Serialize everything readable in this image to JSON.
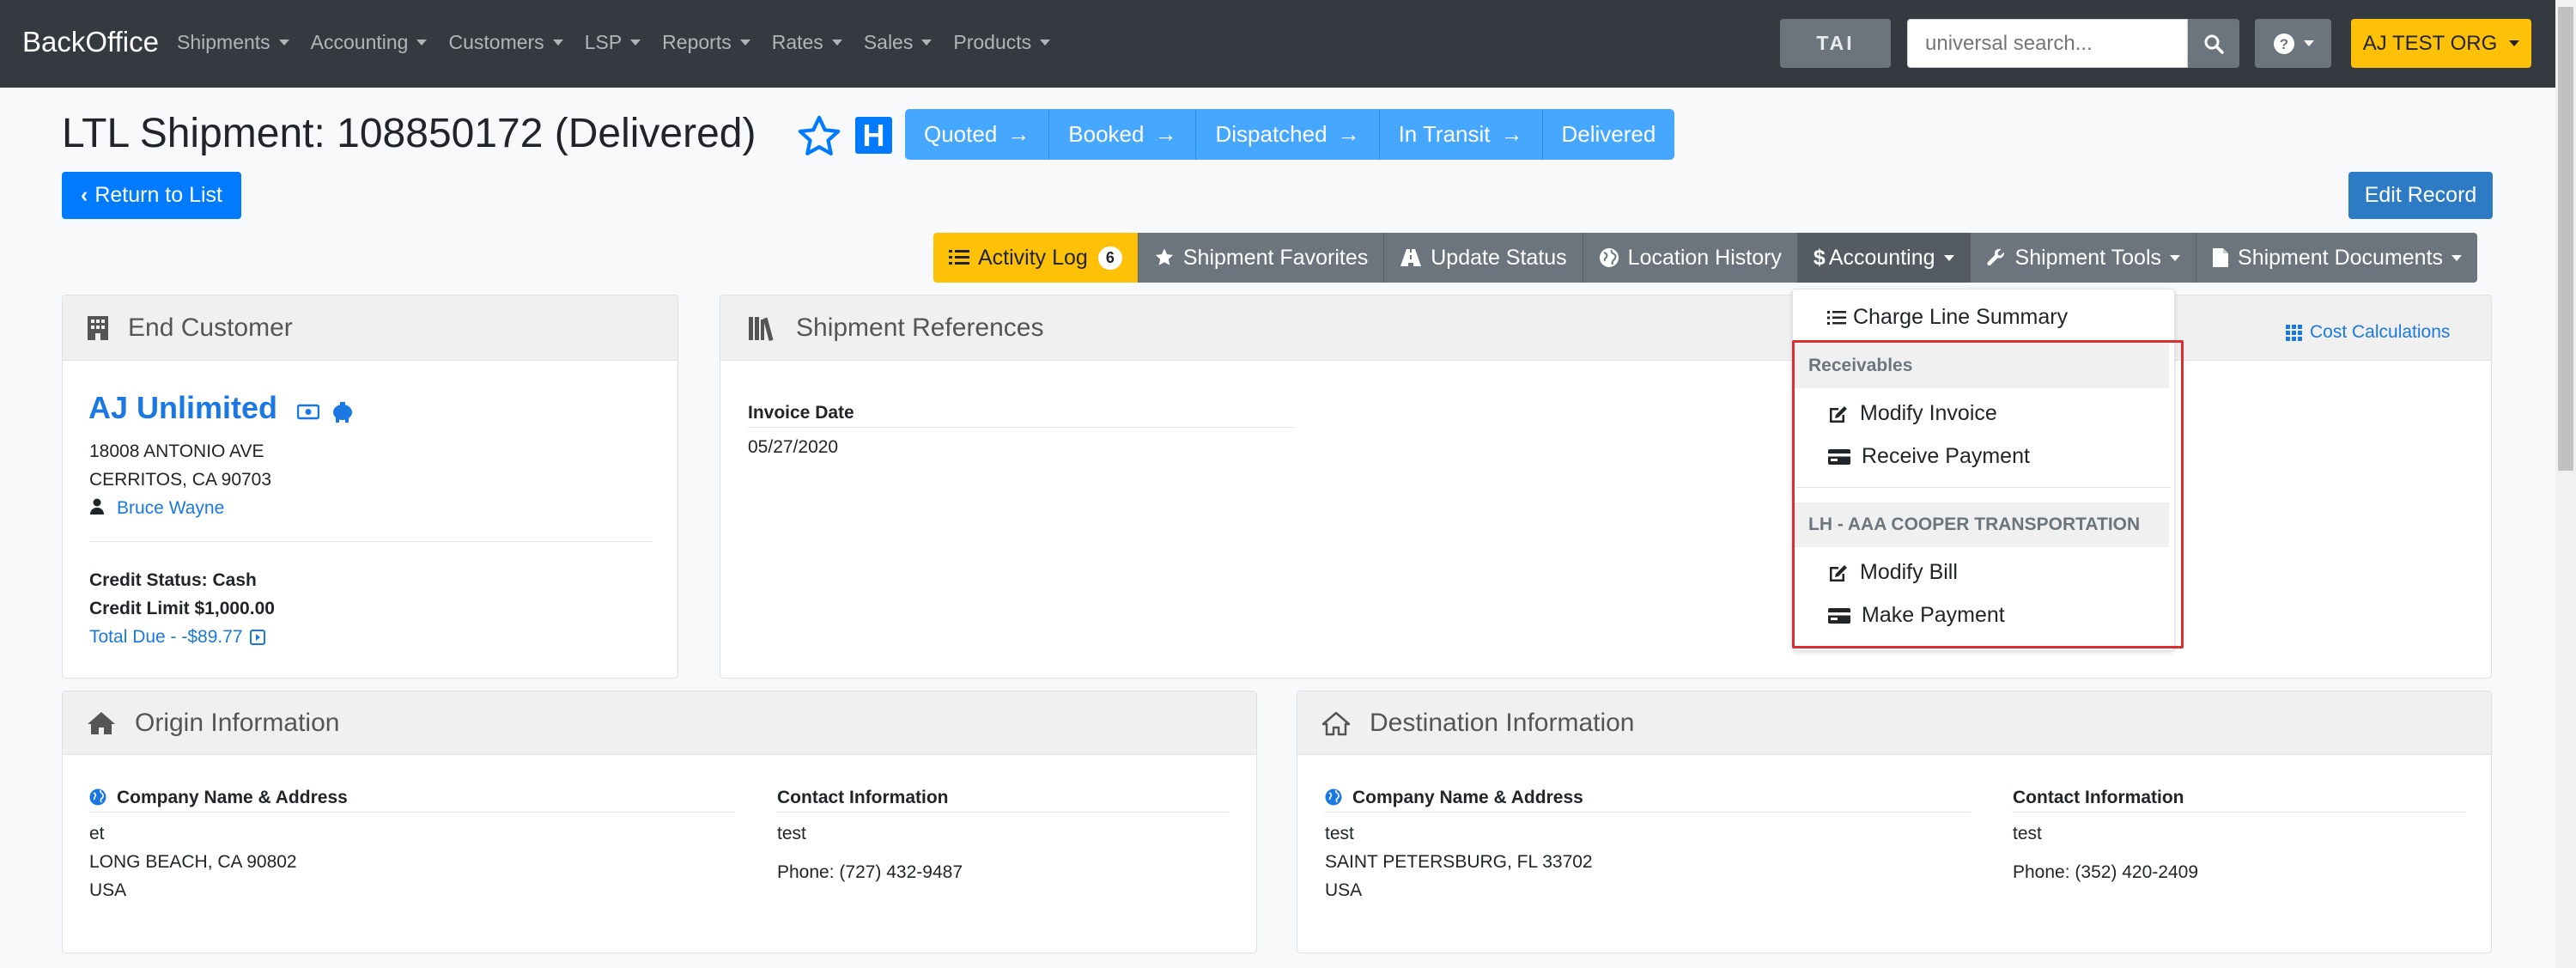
{
  "navbar": {
    "brand": "BackOffice",
    "items": [
      "Shipments",
      "Accounting",
      "Customers",
      "LSP",
      "Reports",
      "Rates",
      "Sales",
      "Products"
    ],
    "tai_label": "TAI",
    "search_placeholder": "universal search...",
    "org_label": "AJ TEST ORG"
  },
  "header": {
    "title": "LTL Shipment: 108850172 (Delivered)",
    "h_badge": "H",
    "status_steps": [
      "Quoted",
      "Booked",
      "Dispatched",
      "In Transit",
      "Delivered"
    ],
    "return_label": "Return to List",
    "edit_label": "Edit Record"
  },
  "toolbar": {
    "activity_log": "Activity Log",
    "activity_count": "6",
    "favorites": "Shipment Favorites",
    "update_status": "Update Status",
    "location_history": "Location History",
    "accounting": "Accounting",
    "tools": "Shipment Tools",
    "documents": "Shipment Documents"
  },
  "accounting_menu": {
    "charge_line_summary": "Charge Line Summary",
    "receivables_header": "Receivables",
    "modify_invoice": "Modify Invoice",
    "receive_payment": "Receive Payment",
    "carrier_header": "LH - AAA COOPER TRANSPORTATION",
    "modify_bill": "Modify Bill",
    "make_payment": "Make Payment"
  },
  "end_customer": {
    "title": "End Customer",
    "name": "AJ Unlimited",
    "address1": "18008 ANTONIO AVE",
    "address2": "CERRITOS, CA 90703",
    "contact": "Bruce Wayne",
    "credit_status": "Credit Status: Cash",
    "credit_limit": "Credit Limit $1,000.00",
    "total_due": "Total Due - -$89.77"
  },
  "shipment_refs": {
    "title": "Shipment References",
    "cost_calc": "Cost Calculations",
    "invoice_date_label": "Invoice Date",
    "invoice_date": "05/27/2020"
  },
  "origin": {
    "title": "Origin Information",
    "company_label": "Company Name & Address",
    "line1": "et",
    "line2": "LONG BEACH, CA 90802",
    "line3": "USA",
    "contact_label": "Contact Information",
    "contact_name": "test",
    "phone": "Phone: (727) 432-9487"
  },
  "destination": {
    "title": "Destination Information",
    "company_label": "Company Name & Address",
    "line1": "test",
    "line2": "SAINT PETERSBURG, FL 33702",
    "line3": "USA",
    "contact_label": "Contact Information",
    "contact_name": "test",
    "phone": "Phone: (352) 420-2409"
  },
  "colors": {
    "navbar": "#343a40",
    "primary": "#007bff",
    "status_step": "#45a7ff",
    "warning": "#ffc107",
    "secondary": "#6c757d",
    "highlight": "#d9302f"
  }
}
